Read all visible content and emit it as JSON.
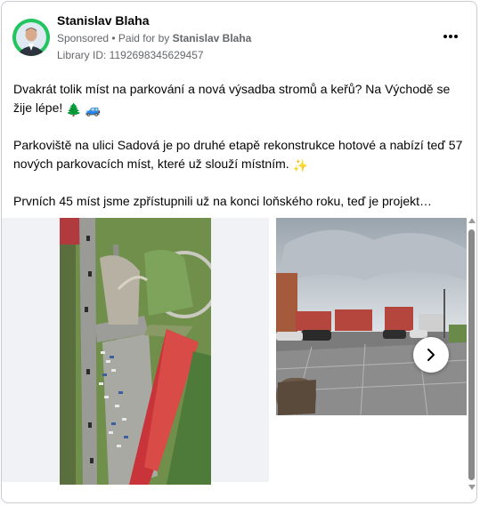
{
  "post": {
    "author": "Stanislav Blaha",
    "sponsored_label": "Sponsored",
    "paid_for_prefix": " • Paid for by ",
    "paid_for_by": "Stanislav Blaha",
    "library_id": "Library ID: 1192698345629457",
    "more_icon": "more-horizontal-icon",
    "paragraphs": [
      "Dvakrát tolik míst na parkování a nová výsadba stromů a keřů? Na Východě se žije lépe!",
      "Parkoviště na ulici Sadová je po druhé etapě rekonstrukce hotové a nabízí teď 57 nových parkovacích míst, které už slouží místním.",
      "Prvních 45 míst jsme zpřístupnili už na konci loňského roku, teď je projekt…"
    ],
    "emoji": {
      "tree": "🌲",
      "car": "🚙",
      "sparkles": "✨"
    }
  },
  "carousel": {
    "next_icon": "chevron-right-icon"
  },
  "colors": {
    "avatar_ring": "#22c55e",
    "roof": "#c8343a",
    "text": "#050505",
    "secondary_text": "#65676b"
  }
}
